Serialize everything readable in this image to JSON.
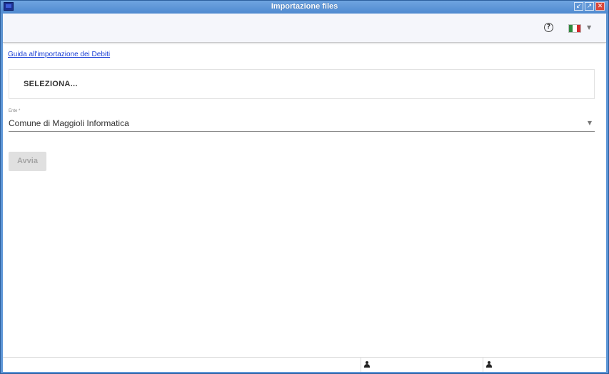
{
  "window": {
    "title": "Importazione files"
  },
  "toolbar": {
    "help_icon": "help-circle-icon",
    "help_glyph": "?",
    "language": "italian-flag-icon",
    "language_caret": "▼"
  },
  "main": {
    "guide_link": "Guida all'importazione dei Debiti",
    "select_label": "SELEZIONA...",
    "ente_label": "Ente *",
    "ente_value": "Comune di Maggioli Informatica",
    "ente_caret": "▼",
    "start_button": "Avvia"
  },
  "colors": {
    "titlebar": "#4f8ad0",
    "link": "#1a3fd6",
    "disabled_button": "#e0e0e0"
  }
}
